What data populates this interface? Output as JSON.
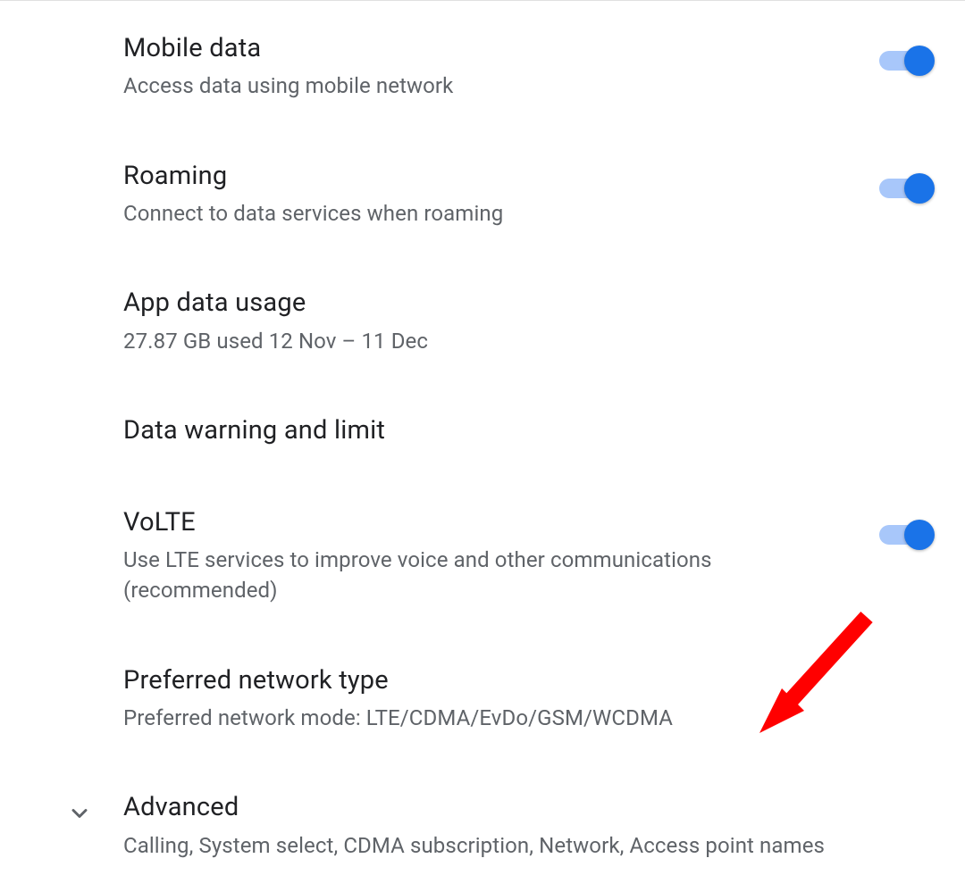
{
  "settings": [
    {
      "key": "mobile_data",
      "title": "Mobile data",
      "subtitle": "Access data using mobile network",
      "has_toggle": true,
      "toggle_on": true
    },
    {
      "key": "roaming",
      "title": "Roaming",
      "subtitle": "Connect to data services when roaming",
      "has_toggle": true,
      "toggle_on": true
    },
    {
      "key": "app_data_usage",
      "title": "App data usage",
      "subtitle": "27.87 GB used 12 Nov – 11 Dec",
      "has_toggle": false
    },
    {
      "key": "data_warning_limit",
      "title": "Data warning and limit",
      "subtitle": "",
      "has_toggle": false
    },
    {
      "key": "volte",
      "title": "VoLTE",
      "subtitle": "Use LTE services to improve voice and other communications (recommended)",
      "has_toggle": true,
      "toggle_on": true
    },
    {
      "key": "preferred_network_type",
      "title": "Preferred network type",
      "subtitle": "Preferred network mode: LTE/CDMA/EvDo/GSM/WCDMA",
      "has_toggle": false
    },
    {
      "key": "advanced",
      "title": "Advanced",
      "subtitle": "Calling, System select, CDMA subscription, Network, Access point names",
      "has_toggle": false,
      "has_chevron": true
    }
  ],
  "colors": {
    "primary": "#1a73e8",
    "track": "#a8c7fa",
    "text_primary": "#202124",
    "text_secondary": "#5f6368",
    "arrow": "#ff0000"
  }
}
